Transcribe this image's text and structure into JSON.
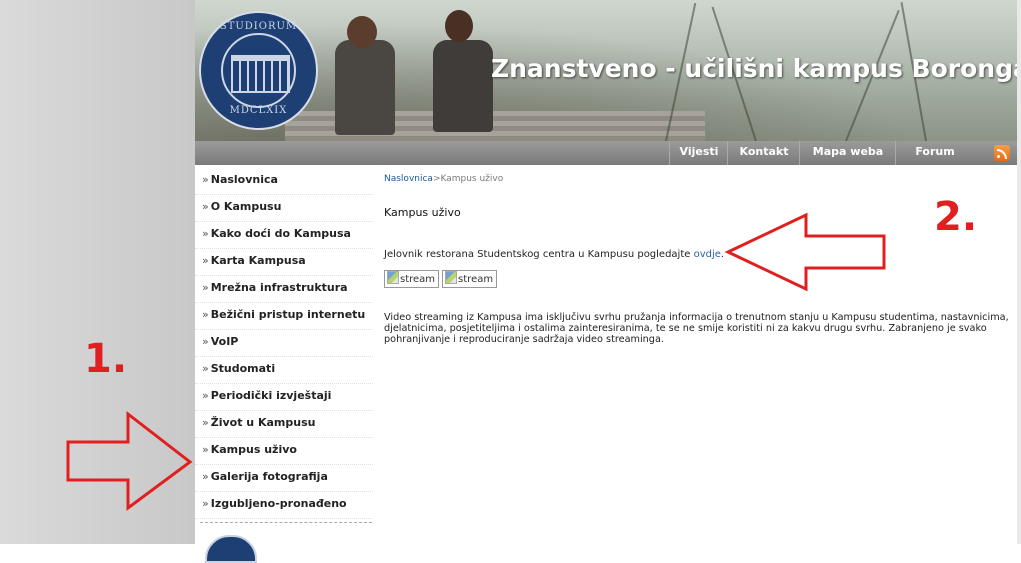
{
  "header": {
    "site_title": "Znanstveno - učilišni kampus Borongaj",
    "seal_text_top": "STUDIORUM",
    "seal_text_bottom": "MDCLXIX"
  },
  "topnav": {
    "items": [
      {
        "label": "Vijesti"
      },
      {
        "label": "Kontakt"
      },
      {
        "label": "Mapa weba"
      },
      {
        "label": "Forum"
      }
    ],
    "rss_icon": "rss-icon"
  },
  "sidebar": {
    "chevron": "»",
    "items": [
      {
        "label": "Naslovnica"
      },
      {
        "label": "O Kampusu"
      },
      {
        "label": "Kako doći do Kampusa"
      },
      {
        "label": "Karta Kampusa"
      },
      {
        "label": "Mrežna infrastruktura"
      },
      {
        "label": "Bežični pristup internetu"
      },
      {
        "label": "VoIP"
      },
      {
        "label": "Studomati"
      },
      {
        "label": "Periodički izvještaji"
      },
      {
        "label": "Život u Kampusu"
      },
      {
        "label": "Kampus uživo"
      },
      {
        "label": "Galerija fotografija"
      },
      {
        "label": "Izgubljeno-pronađeno"
      }
    ]
  },
  "main": {
    "breadcrumb": {
      "home": "Naslovnica",
      "separator": ">",
      "current": "Kampus uživo"
    },
    "heading": "Kampus uživo",
    "menu_text": "Jelovnik restorana Studentskog centra u Kampusu pogledajte ",
    "menu_link": "ovdje",
    "menu_end": ".",
    "stream_buttons": [
      "stream",
      "stream"
    ],
    "paragraph": "Video streaming iz Kampusa ima isključivu svrhu pružanja informacija o trenutnom stanju u Kampusu studentima, nastavnicima, djelatnicima, posjetiteljima i ostalima zainteresiranima, te se ne smije koristiti ni za kakvu drugu svrhu. Zabranjeno je svako pohranjivanje i reproduciranje sadržaja video streaminga."
  },
  "annotations": {
    "label_1": "1.",
    "label_2": "2.",
    "color": "#e02020"
  }
}
